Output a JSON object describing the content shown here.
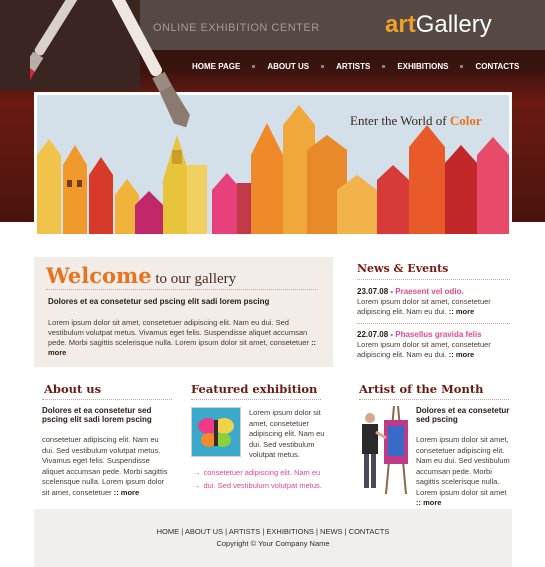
{
  "header": {
    "tagline": "ONLINE EXHIBITION CENTER",
    "logo_art": "art",
    "logo_gallery": "Gallery"
  },
  "nav": [
    "HOME PAGE",
    "ABOUT US",
    "ARTISTS",
    "EXHIBITIONS",
    "CONTACTS"
  ],
  "banner": {
    "headline": "Enter the World of",
    "headline_accent": "Color"
  },
  "welcome": {
    "title_big": "Welcome",
    "title_rest": " to our gallery",
    "subtitle": "Dolores et ea consetetur sed pscing elit sadi lorem pscing",
    "text": "Lorem ipsum dolor sit amet, consetetuer adipiscing elit. Nam eu dui. Sed vestibulum volutpat metus. Vivamus eget felis. Suspendisse aliquet accumsan pede. Morbi sagittis scelerisque nulla. Lorem ipsum dolor sit amet, consetetuer",
    "more": ":: more"
  },
  "news": {
    "title": "News & Events",
    "items": [
      {
        "date": "23.07.08",
        "sep": " - ",
        "headline": "Praesent vel odio.",
        "text": "Lorem ipsum dolor sit amet, consetetuer adipiscing elit. Nam eu dui.",
        "more": ":: more"
      },
      {
        "date": "22.07.08",
        "sep": " - ",
        "headline": "Phasellus gravida felis",
        "text": "Lorem ipsum dolor sit amet, consetetuer adipiscing elit. Nam eu dui.",
        "more": ":: more"
      }
    ]
  },
  "about": {
    "title": "About us",
    "subtitle": "Dolores et ea consetetur sed pscing elit sadi lorem pscing",
    "text": "consetetuer adipiscing elit. Nam eu dui. Sed vestibulum volutpat metus. Vivamus eget felis. Suspendisse aliquet accumsan pede. Morbi sagittis scelerisque nulla. Lorem ipsum dolor sit amet, consetetuer",
    "more": ":: more"
  },
  "featured": {
    "title": "Featured exhibition",
    "text": "Lorem ipsum dolor sit amet, consetetuer adipiscing elit. Nam eu dui. Sed vestibulum volutpat metus.",
    "links": [
      "consetetuer adipiscing elit. Nam eu",
      "dui. Sed vestibulum volutpat metus."
    ]
  },
  "artist": {
    "title": "Artist of the Month",
    "subtitle": "Dolores et ea consetetur sed pscing",
    "text": "Lorem ipsum dolor sit amet, consetetuer adipiscing elit. Nam eu dui. Sed vestibulum accumsan pede. Morbi sagittis scelerisque nulla. Lorem ipsum dolor sit amet",
    "more": ":: more"
  },
  "footer": {
    "links": [
      "HOME",
      "ABOUT US",
      "ARTISTS",
      "EXHIBITIONS",
      "NEWS",
      "CONTACTS"
    ],
    "separator": " | ",
    "copyright": "Copyright © Your Company Name"
  },
  "colors": {
    "accent": "#e8721e",
    "pink": "#e34a8a",
    "maroon": "#7a1a10",
    "header_bg": "#564843"
  }
}
